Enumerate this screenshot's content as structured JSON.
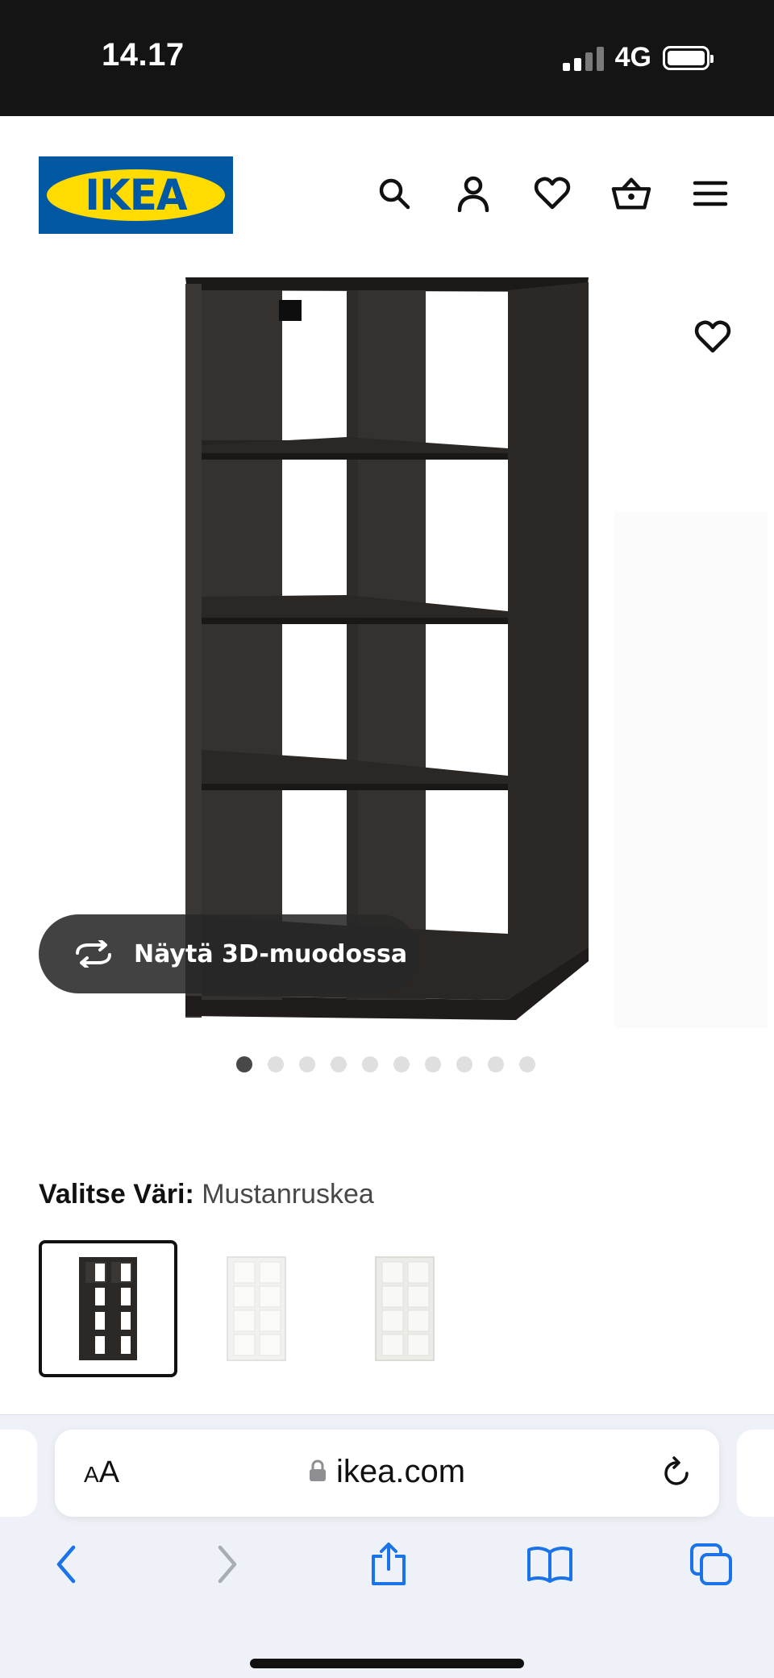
{
  "status_bar": {
    "time": "14.17",
    "network": "4G"
  },
  "header": {
    "logo_text": "IKEA",
    "icons": [
      "search-icon",
      "account-icon",
      "favourites-icon",
      "cart-icon",
      "menu-icon"
    ]
  },
  "product": {
    "view_3d_label": "Näytä 3D-muodossa",
    "gallery_dots": 10,
    "gallery_active_index": 0,
    "color_label": "Valitse Väri:",
    "color_value": "Mustanruskea",
    "swatches": [
      {
        "color": "#2b2826",
        "selected": true
      },
      {
        "color": "#f4f4f2",
        "selected": false
      },
      {
        "color": "#ecece8",
        "selected": false
      }
    ]
  },
  "browser": {
    "text_size_label": "AA",
    "url": "ikea.com"
  },
  "colors": {
    "ikea_blue": "#0058a3",
    "ikea_yellow": "#ffdb00",
    "shelf": "#2e2a28",
    "ios_blue": "#1a73e8"
  }
}
